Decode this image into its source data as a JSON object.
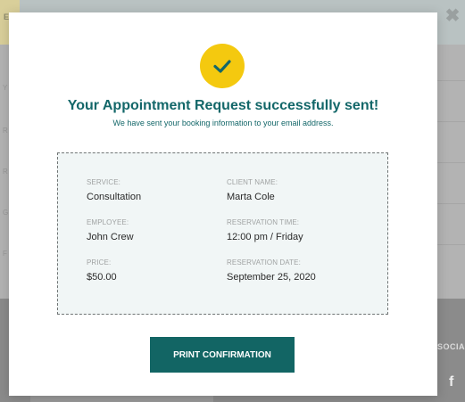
{
  "background": {
    "header_accent_text": "EF",
    "social_label": "SOCIA",
    "facebook_glyph": "f",
    "left_marks": [
      "Y",
      "R",
      "R",
      "G",
      "F"
    ]
  },
  "modal": {
    "close_glyph": "✖",
    "icon": "checkmark-icon",
    "title": "Your Appointment Request successfully sent!",
    "subtitle": "We have sent your booking information to your email address.",
    "fields": {
      "service": {
        "label": "SERVICE:",
        "value": "Consultation"
      },
      "client_name": {
        "label": "CLIENT NAME:",
        "value": "Marta Cole"
      },
      "employee": {
        "label": "EMPLOYEE:",
        "value": "John Crew"
      },
      "reservation_time": {
        "label": "RESERVATION TIME:",
        "value": "12:00 pm / Friday"
      },
      "price": {
        "label": "PRICE:",
        "value": "$50.00"
      },
      "reservation_date": {
        "label": "RESERVATION DATE:",
        "value": "September 25, 2020"
      }
    },
    "print_button_label": "PRINT CONFIRMATION"
  },
  "colors": {
    "primary": "#126564",
    "accent": "#f4c90f",
    "summary_bg": "#f1f6f6"
  }
}
